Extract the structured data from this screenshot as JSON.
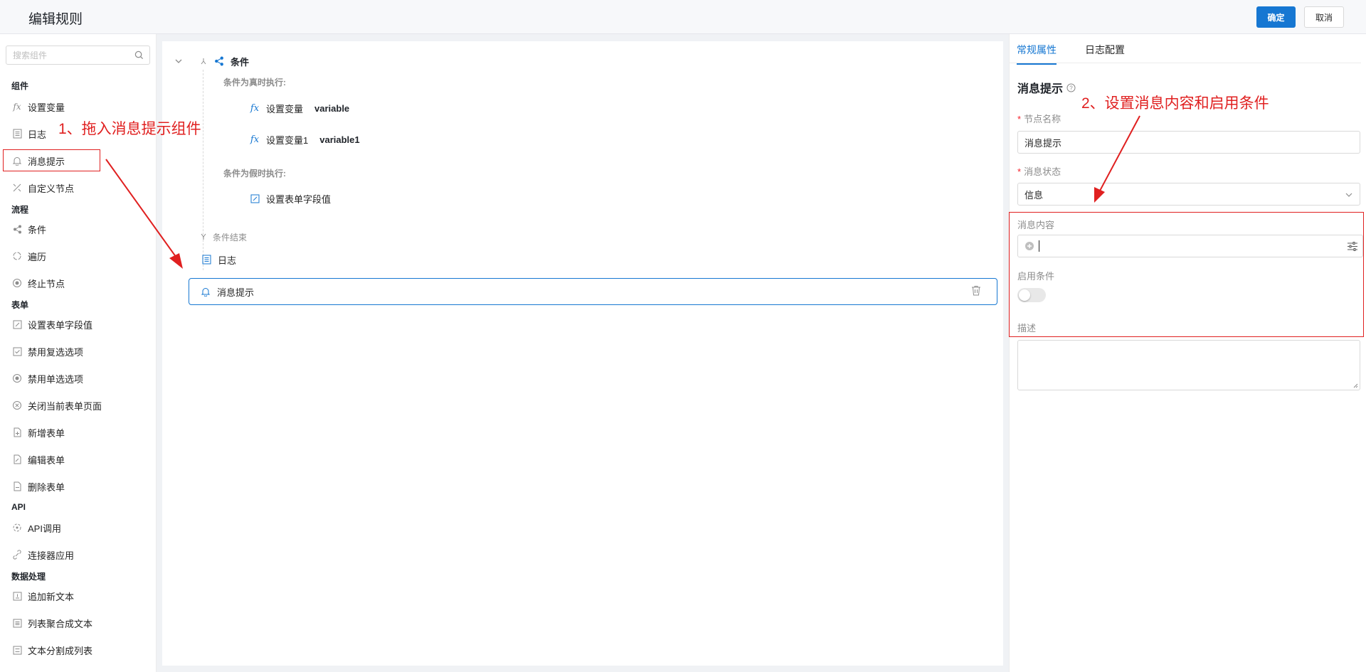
{
  "header": {
    "title": "编辑规则",
    "confirm": "确定",
    "cancel": "取消"
  },
  "sidebar": {
    "search_placeholder": "搜索组件",
    "sections": {
      "components": "组件",
      "flow": "流程",
      "form": "表单",
      "api": "API",
      "data": "数据处理"
    },
    "items": {
      "set_var": "设置变量",
      "log": "日志",
      "message": "消息提示",
      "custom_node": "自定义节点",
      "condition": "条件",
      "loop": "遍历",
      "end_node": "终止节点",
      "set_field": "设置表单字段值",
      "disable_checkbox": "禁用复选选项",
      "disable_radio": "禁用单选选项",
      "close_form": "关闭当前表单页面",
      "add_form": "新增表单",
      "edit_form": "编辑表单",
      "delete_form": "删除表单",
      "api_call": "API调用",
      "connector": "连接器应用",
      "append_text": "追加新文本",
      "list_join": "列表聚合成文本",
      "text_split": "文本分割成列表"
    }
  },
  "canvas": {
    "condition": "条件",
    "true_label": "条件为真时执行:",
    "set_var": "设置变量",
    "var_name": "variable",
    "set_var1": "设置变量1",
    "var_name1": "variable1",
    "false_label": "条件为假时执行:",
    "set_field": "设置表单字段值",
    "cond_end": "条件结束",
    "log": "日志",
    "message": "消息提示"
  },
  "panel": {
    "tabs": [
      "常规属性",
      "日志配置"
    ],
    "section_title": "消息提示",
    "node_name_label": "节点名称",
    "node_name_value": "消息提示",
    "status_label": "消息状态",
    "status_value": "信息",
    "content_label": "消息内容",
    "enable_label": "启用条件",
    "enable_on": false,
    "desc_label": "描述"
  },
  "annotations": {
    "step1": "1、拖入消息提示组件",
    "step2": "2、设置消息内容和启用条件",
    "color": "#e02020"
  },
  "colors": {
    "accent": "#1677d2",
    "required": "#f5222d"
  }
}
